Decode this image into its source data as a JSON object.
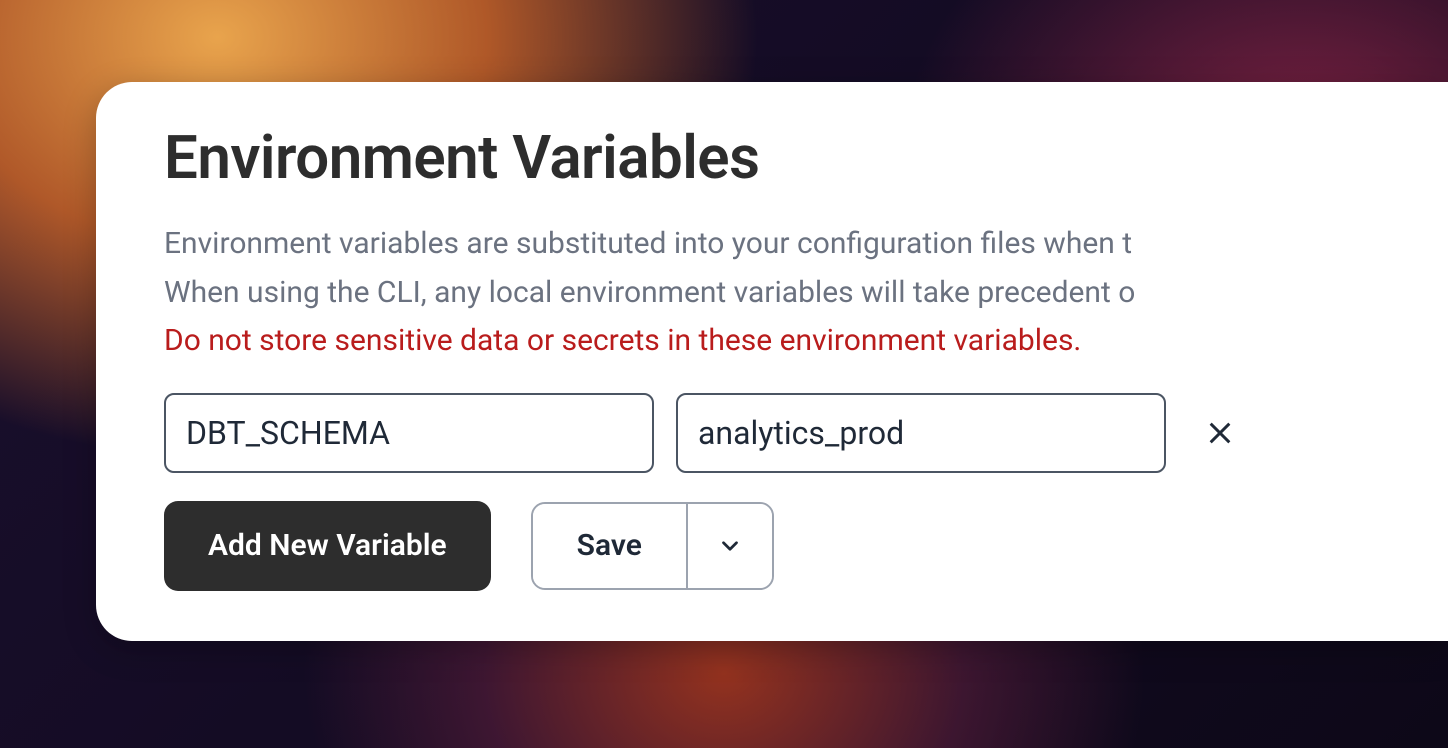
{
  "panel": {
    "title": "Environment Variables",
    "description_line1": "Environment variables are substituted into your configuration files when t",
    "description_line2": "When using the CLI, any local environment variables will take precedent o",
    "warning": "Do not store sensitive data or secrets in these environment variables."
  },
  "variables": [
    {
      "key": "DBT_SCHEMA",
      "value": "analytics_prod"
    }
  ],
  "actions": {
    "add_label": "Add New Variable",
    "save_label": "Save"
  }
}
